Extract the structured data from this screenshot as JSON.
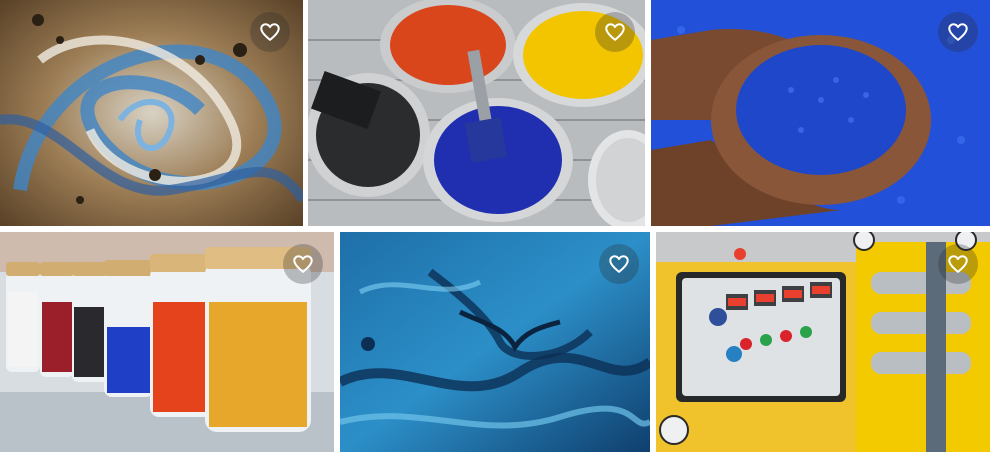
{
  "gallery": {
    "tiles": [
      {
        "id": "paint-swirl-gold-blue",
        "favorite_icon": "heart-outline-icon"
      },
      {
        "id": "paint-cans-brushes",
        "favorite_icon": "heart-outline-icon"
      },
      {
        "id": "blue-plastic-pellets-hands",
        "favorite_icon": "heart-outline-icon"
      },
      {
        "id": "colored-pellet-jars",
        "favorite_icon": "heart-outline-icon"
      },
      {
        "id": "blue-marble-texture",
        "favorite_icon": "heart-outline-icon"
      },
      {
        "id": "yellow-extruder-machine",
        "favorite_icon": "heart-outline-icon"
      }
    ]
  },
  "colors": {
    "heart_stroke": "#ffffff",
    "heart_bg": "rgba(40,40,40,0.28)",
    "accent_blue": "#2f5fd6",
    "accent_yellow": "#f3c400"
  }
}
